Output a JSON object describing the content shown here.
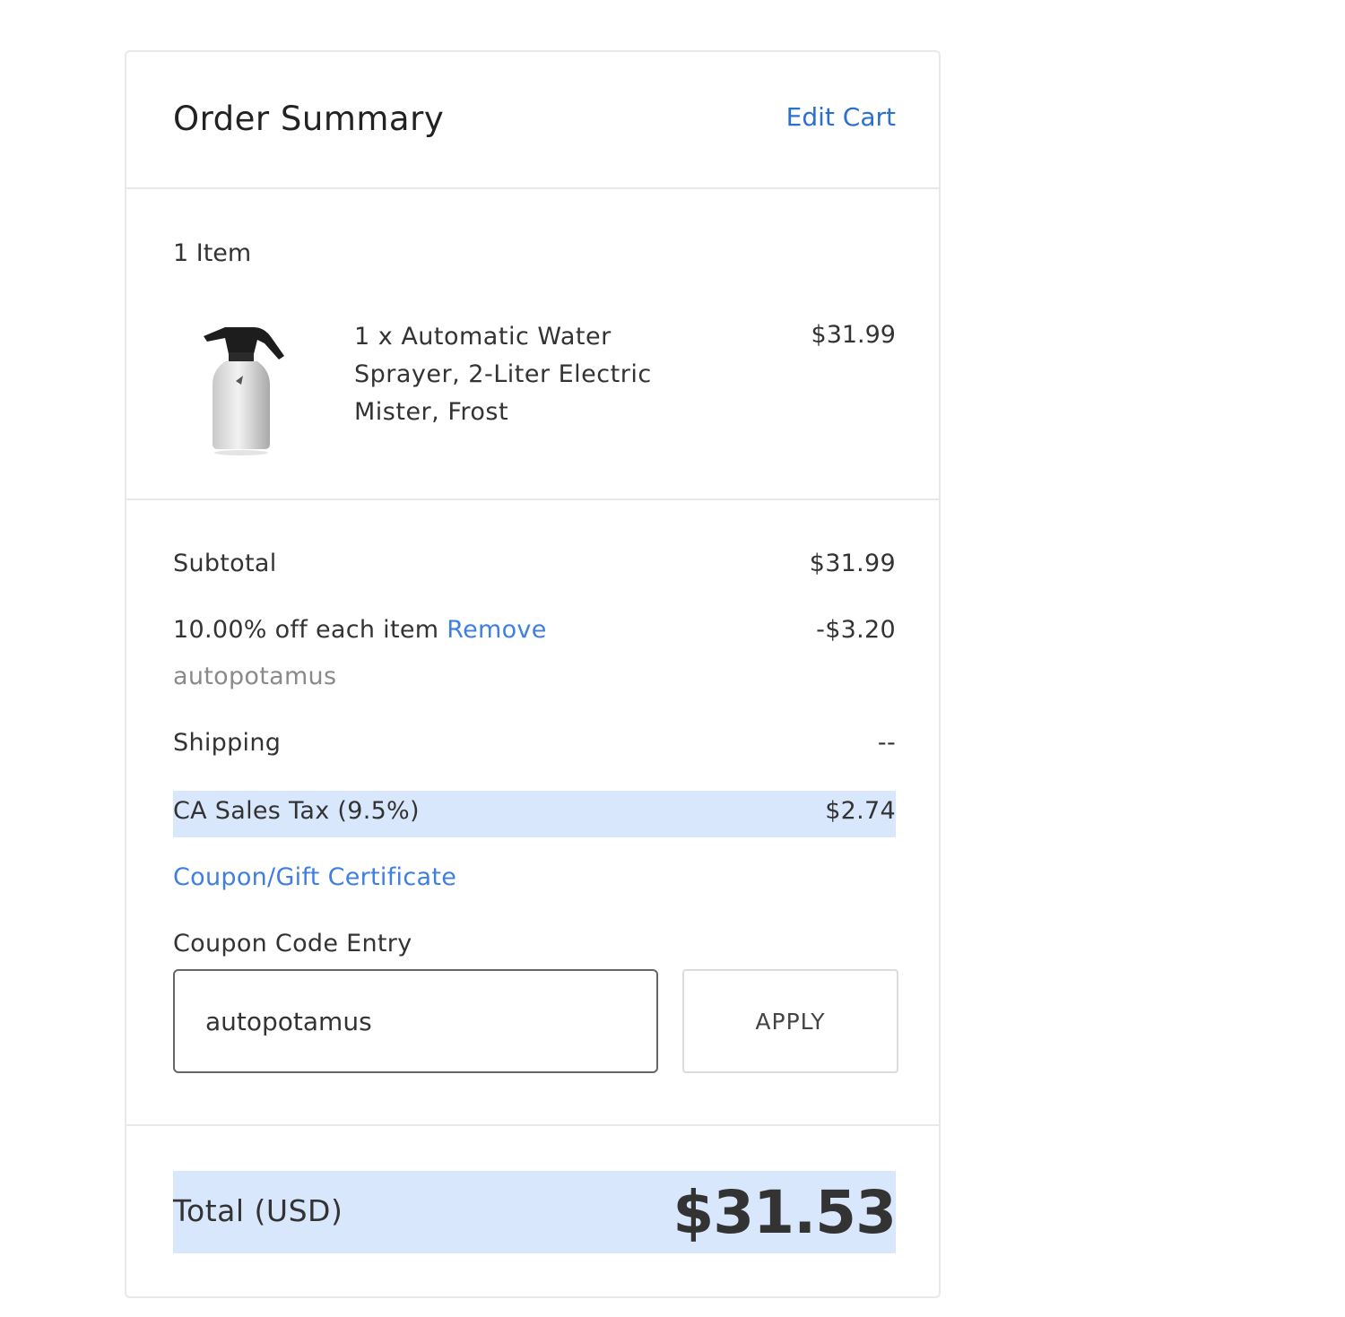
{
  "header": {
    "title": "Order Summary",
    "edit_cart_label": "Edit Cart"
  },
  "items": {
    "count_label": "1 Item",
    "list": [
      {
        "image_icon": "spray-bottle-icon",
        "name": "1 x Automatic Water Sprayer, 2-Liter Electric Mister, Frost",
        "price": "$31.99"
      }
    ]
  },
  "totals": {
    "subtotal_label": "Subtotal",
    "subtotal_value": "$31.99",
    "discount_label": "10.00% off each item",
    "discount_remove_label": "Remove",
    "discount_value": "-$3.20",
    "discount_code": "autopotamus",
    "shipping_label": "Shipping",
    "shipping_value": "--",
    "tax_label": "CA Sales Tax (9.5%)",
    "tax_value": "$2.74"
  },
  "coupon": {
    "toggle_label": "Coupon/Gift Certificate",
    "field_label": "Coupon Code Entry",
    "input_value": "autopotamus",
    "apply_label": "APPLY"
  },
  "grand_total": {
    "label": "Total (USD)",
    "value": "$31.53"
  },
  "colors": {
    "link": "#3f7fe3",
    "highlight": "#d9e7fc",
    "border": "#e9e9e9"
  }
}
